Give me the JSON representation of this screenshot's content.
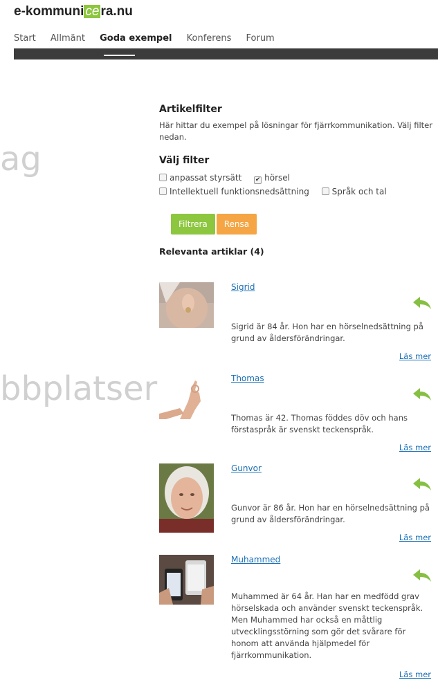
{
  "header": {
    "logo_pre": "e-kommuni",
    "logo_mid": "ce",
    "logo_post": "ra.nu",
    "nav": [
      "Start",
      "Allmänt",
      "Goda exempel",
      "Konferens",
      "Forum"
    ],
    "active_nav": "Goda exempel"
  },
  "background_text": [
    "ag",
    "bbplatserna"
  ],
  "filter": {
    "title": "Artikelfilter",
    "intro": "Här hittar du exempel på lösningar för fjärrkommunikation. Välj filter nedan.",
    "choose_title": "Välj filter",
    "options": [
      {
        "label": "anpassat styrsätt",
        "checked": false
      },
      {
        "label": "hörsel",
        "checked": true
      },
      {
        "label": "Intellektuell funktionsnedsättning",
        "checked": false
      },
      {
        "label": "Språk och tal",
        "checked": false
      }
    ],
    "filter_button": "Filtrera",
    "reset_button": "Rensa"
  },
  "results": {
    "heading": "Relevanta artiklar (4)",
    "read_more": "Läs mer",
    "articles": [
      {
        "name": "Sigrid",
        "description": "Sigrid är 84 år. Hon har en hörselnedsättning på grund av åldersförändringar."
      },
      {
        "name": "Thomas",
        "description": "Thomas är 42. Thomas föddes döv och hans förstaspråk är svenskt teckenspråk."
      },
      {
        "name": "Gunvor",
        "description": "Gunvor är 86 år. Hon har en hörselnedsättning på grund av åldersförändringar."
      },
      {
        "name": "Muhammed",
        "description": "Muhammed är 64 år. Han har en medfödd grav hörselskada och använder svenskt teckenspråk. Men Muhammed har också en måttlig utvecklingsstörning som gör det svårare för honom att använda hjälpmedel för fjärrkommunikation."
      }
    ]
  },
  "colors": {
    "accent_green": "#8dc63f",
    "accent_orange": "#f5a544",
    "link_blue": "#1a6fb5",
    "nav_bar": "#3c3c3c"
  },
  "icons": {
    "share_arrow": "reply-arrow-icon"
  }
}
